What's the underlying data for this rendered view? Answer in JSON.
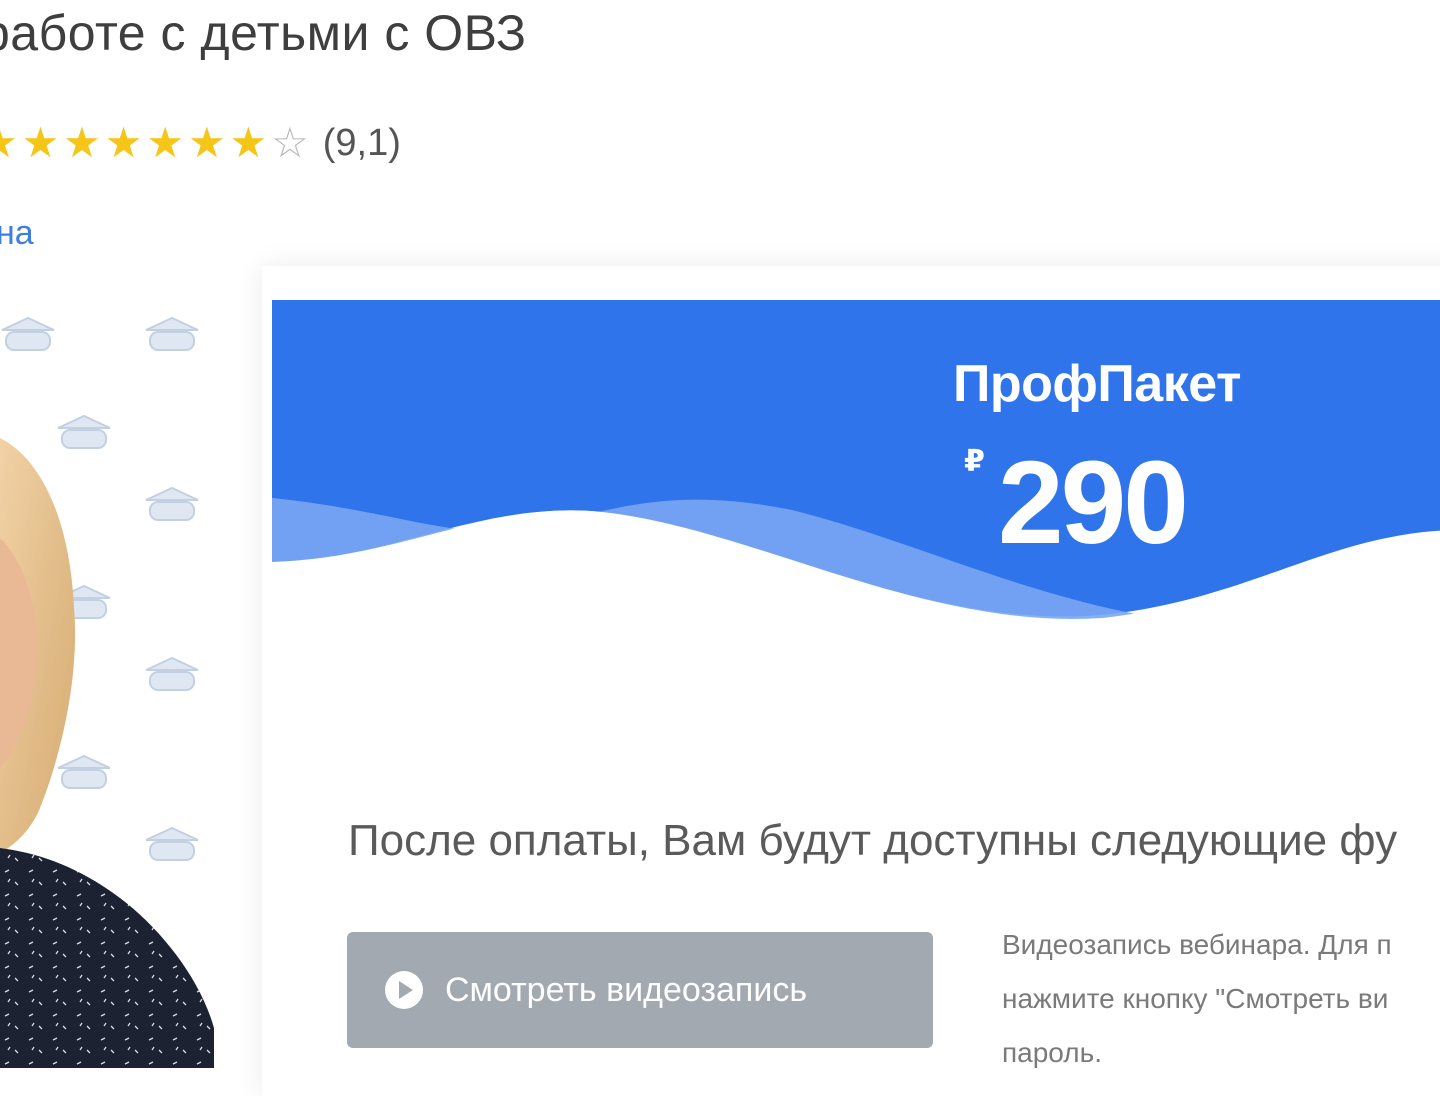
{
  "course": {
    "title": "работе с детьми с ОВЗ",
    "rating": 9.1,
    "rating_text": "(9,1)",
    "stars": {
      "filled": 7,
      "empty": 1,
      "visible_total": 8
    },
    "author_link_text": "на"
  },
  "package": {
    "name": "ПрофПакет",
    "currency_symbol": "₽",
    "price": "290"
  },
  "access": {
    "heading": "После оплаты, Вам будут доступны следующие фу",
    "watch_button_label": "Смотреть видеозапись",
    "description_lines": [
      "Видеозапись вебинара. Для п",
      "нажмите кнопку \"Смотреть ви",
      "пароль."
    ]
  },
  "colors": {
    "accent_blue": "#3d7ee0",
    "header_blue": "#2f74ea",
    "wave_light": "#7aa6f4",
    "star_gold": "#f5c518",
    "button_gray": "#a3a9b1"
  },
  "icons": [
    "play-icon",
    "star-icon",
    "institution-icon"
  ]
}
